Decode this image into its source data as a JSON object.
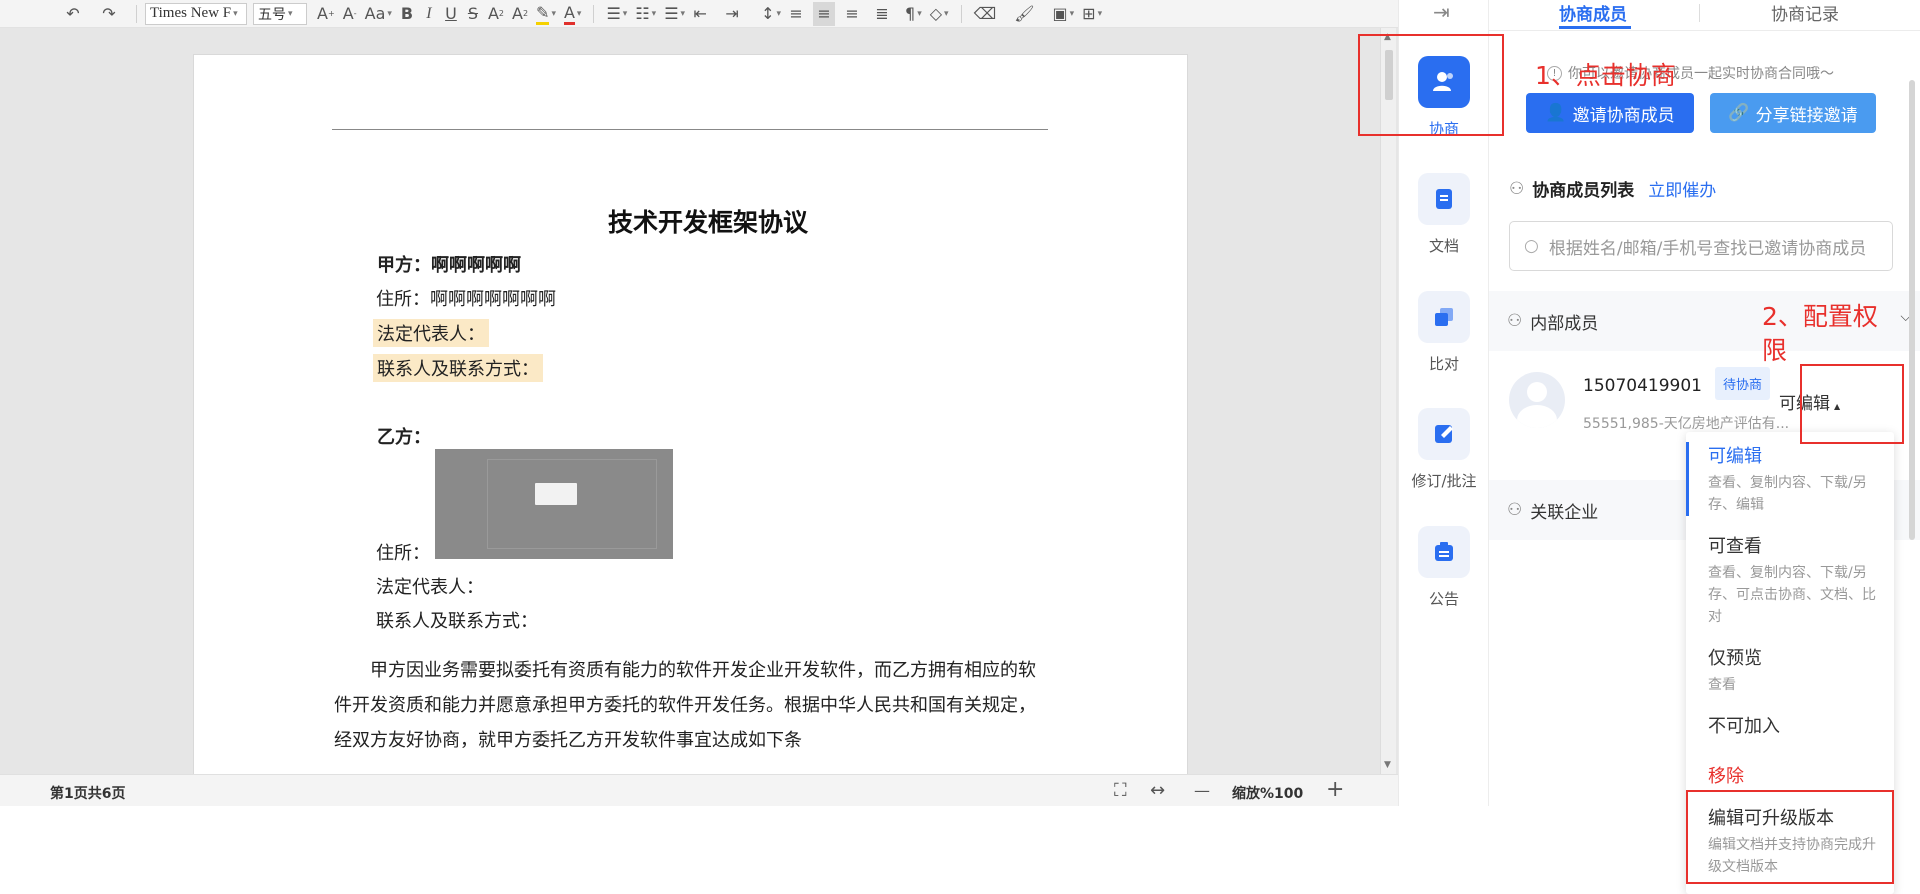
{
  "toolbar": {
    "font_name": "Times New F",
    "font_size": "五号",
    "icons": [
      "undo-icon",
      "redo-icon",
      "grow-font-icon",
      "shrink-font-icon",
      "change-case-icon",
      "bold-icon",
      "italic-icon",
      "underline-icon",
      "strikethrough-icon",
      "superscript-icon",
      "subscript-icon",
      "highlight-icon",
      "font-color-icon",
      "bullet-list-icon",
      "numbered-list-icon",
      "multilevel-list-icon",
      "decrease-indent-icon",
      "increase-indent-icon",
      "line-spacing-icon",
      "align-left-icon",
      "align-center-icon",
      "align-right-icon",
      "justify-icon",
      "paragraph-mark-icon",
      "clear-format-icon",
      "eraser-icon",
      "format-painter-icon",
      "insert-image-icon",
      "insert-table-icon"
    ]
  },
  "document": {
    "title": "技术开发框架协议",
    "party_a_label": "甲方：啊啊啊啊啊",
    "party_a_address": "住所：啊啊啊啊啊啊啊",
    "party_a_legal_rep": "法定代表人：",
    "party_a_contact": "联系人及联系方式：",
    "party_b_label": "乙方：",
    "party_b_address": "住所：",
    "party_b_legal_rep": "法定代表人：",
    "party_b_contact": "联系人及联系方式：",
    "body": "甲方因业务需要拟委托有资质有能力的软件开发企业开发软件，而乙方拥有相应的软件开发资质和能力并愿意承担甲方委托的软件开发任务。根据中华人民共和国有关规定，经双方友好协商，就甲方委托乙方开发软件事宜达成如下条"
  },
  "statusbar": {
    "page_info": "第1页共6页",
    "zoom_label": "缩放%100",
    "zoom_out": "—",
    "zoom_in": "+"
  },
  "side_nav": [
    {
      "label": "协商",
      "icon": "users-icon",
      "active": true
    },
    {
      "label": "文档",
      "icon": "document-icon",
      "active": false
    },
    {
      "label": "比对",
      "icon": "compare-icon",
      "active": false
    },
    {
      "label": "修订/批注",
      "icon": "revise-icon",
      "active": false
    },
    {
      "label": "公告",
      "icon": "announcement-icon",
      "active": false
    }
  ],
  "panel": {
    "tab_members": "协商成员",
    "tab_records": "协商记录",
    "notice": "你可以邀请协商成员一起实时协商合同哦～",
    "invite_button": "邀请协商成员",
    "share_button": "分享链接邀请",
    "member_list_title": "协商成员列表",
    "urge_link": "立即催办",
    "search_placeholder": "根据姓名/邮箱/手机号查找已邀请协商成员",
    "internal_members": "内部成员",
    "member": {
      "name": "15070419901",
      "status": "待协商",
      "org": "55551,985-天亿房地产评估有...",
      "permission": "可编辑"
    },
    "related_companies": "关联企业"
  },
  "dropdown": [
    {
      "title": "可编辑",
      "desc": "查看、复制内容、下载/另存、编辑",
      "selected": true
    },
    {
      "title": "可查看",
      "desc": "查看、复制内容、下载/另存、可点击协商、文档、比对",
      "selected": false
    },
    {
      "title": "仅预览",
      "desc": "查看",
      "selected": false
    },
    {
      "title": "不可加入",
      "desc": "",
      "selected": false
    },
    {
      "title": "移除",
      "desc": "",
      "selected": false,
      "danger": true
    },
    {
      "title": "编辑可升级版本",
      "desc": "编辑文档并支持协商完成升级文档版本",
      "selected": false
    }
  ],
  "annotations": {
    "step1": "1、点击协商",
    "step2": "2、配置权限"
  },
  "colors": {
    "primary": "#2a6ef0",
    "share_button": "#4a9bf0",
    "annotation": "#e8302c",
    "highlight": "#fbe9c6",
    "danger": "#e8302c"
  }
}
